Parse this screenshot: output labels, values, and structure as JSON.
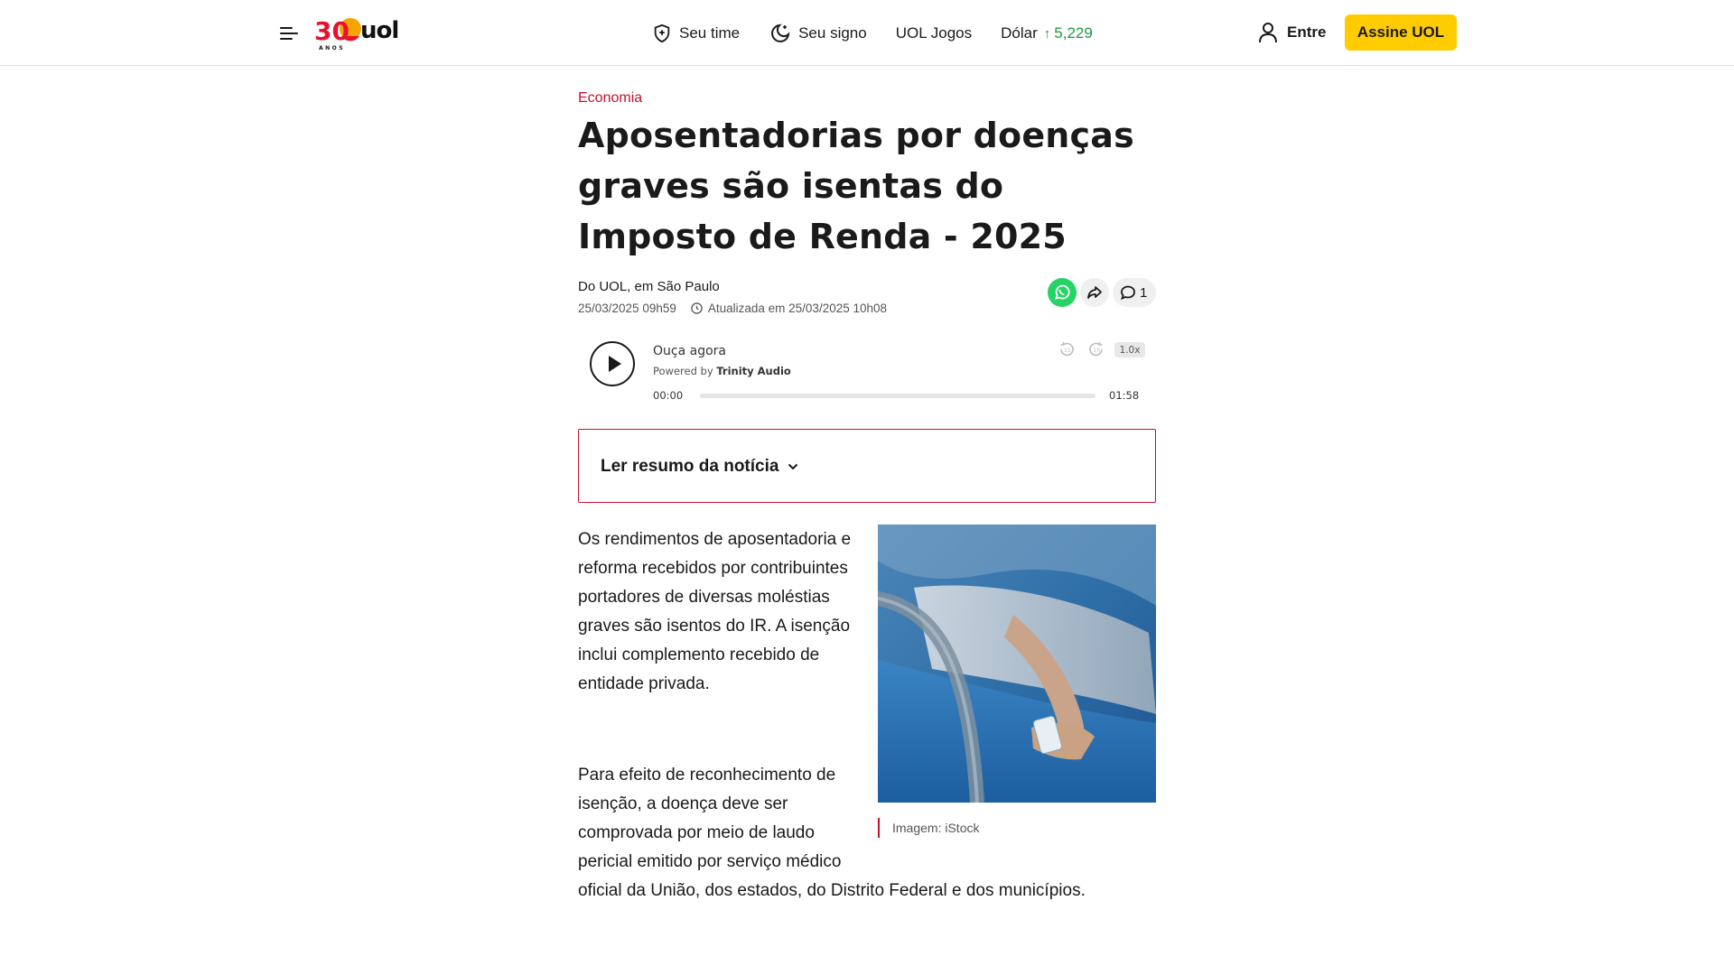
{
  "header": {
    "logo_text": "uol",
    "logo_anniversary": "30",
    "logo_sub": "ANOS",
    "nav": {
      "time_label": "Seu time",
      "signo_label": "Seu signo",
      "jogos_label": "UOL Jogos",
      "dolar_label": "Dólar",
      "dolar_arrow": "↑",
      "dolar_value": "5,229"
    },
    "login_label": "Entre",
    "subscribe_label": "Assine UOL"
  },
  "article": {
    "category": "Economia",
    "title": "Aposentadorias por doenças graves são isentas do Imposto de Renda - 2025",
    "byline": "Do UOL, em São Paulo",
    "published": "25/03/2025 09h59",
    "updated": "Atualizada em 25/03/2025 10h08",
    "comment_count": "1",
    "player": {
      "label": "Ouça agora",
      "powered_prefix": "Powered by",
      "powered_brand": "Trinity Audio",
      "time_start": "00:00",
      "time_end": "01:58",
      "speed": "1.0x",
      "progress": 0
    },
    "summary_label": "Ler resumo da notícia",
    "paragraph1": "Os rendimentos de aposentadoria e reforma recebidos por contribuintes portadores de diversas moléstias graves são isentos do IR. A isenção inclui complemento recebido de entidade privada.",
    "paragraph2": "Para efeito de reconhecimento de isenção, a doença deve ser comprovada por meio de laudo pericial emitido por serviço médico oficial da União, dos estados, do Distrito Federal e dos municípios.",
    "image_caption": "Imagem: iStock"
  },
  "colors": {
    "accent": "#c8102e",
    "subscribe": "#ffcc00",
    "dolar_up": "#1f9a3e",
    "whatsapp": "#25d366"
  },
  "icons": [
    "menu-icon",
    "shield-icon",
    "moon-stars-icon",
    "user-icon",
    "whatsapp-icon",
    "share-icon",
    "comment-icon",
    "play-icon",
    "rewind-icon",
    "forward-icon",
    "clock-icon",
    "chevron-down-icon"
  ]
}
